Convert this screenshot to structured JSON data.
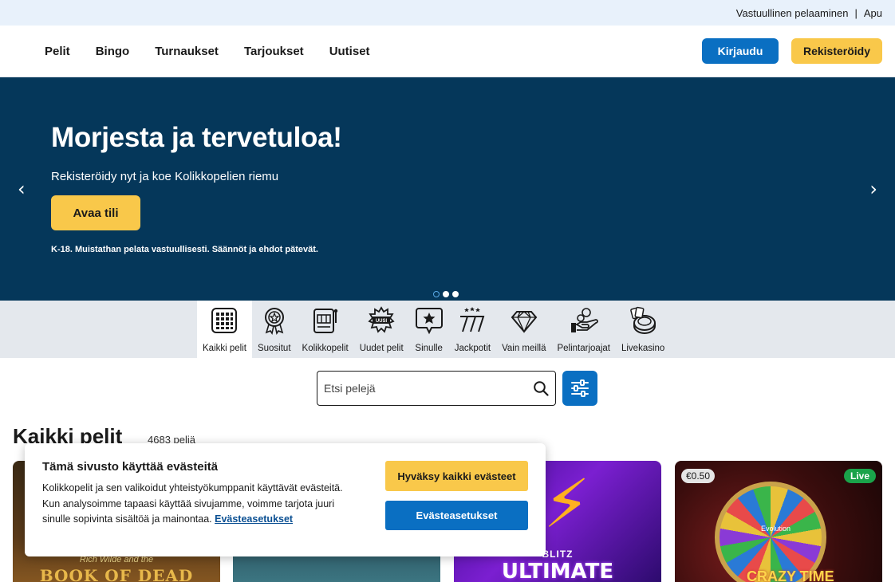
{
  "topbar": {
    "responsible": "Vastuullinen pelaaminen",
    "separator": "|",
    "help": "Apu"
  },
  "nav": {
    "items": [
      "Pelit",
      "Bingo",
      "Turnaukset",
      "Tarjoukset",
      "Uutiset"
    ]
  },
  "header": {
    "login_label": "Kirjaudu",
    "register_label": "Rekisteröidy"
  },
  "hero": {
    "title": "Morjesta ja tervetuloa!",
    "subtitle": "Rekisteröidy nyt ja koe Kolikkopelien riemu",
    "cta_label": "Avaa tili",
    "disclaimer": "K-18. Muistathan pelata vastuullisesti. Säännöt ja ehdot pätevät.",
    "prev_icon": "‹",
    "next_icon": "›",
    "slides": 3,
    "active_slide": 1
  },
  "categories": [
    {
      "label": "Kaikki pelit",
      "icon": "grid-icon",
      "active": true
    },
    {
      "label": "Suositut",
      "icon": "award-icon",
      "active": false
    },
    {
      "label": "Kolikkopelit",
      "icon": "slot-machine-icon",
      "active": false
    },
    {
      "label": "Uudet pelit",
      "icon": "new-badge-icon",
      "active": false
    },
    {
      "label": "Sinulle",
      "icon": "star-bubble-icon",
      "active": false
    },
    {
      "label": "Jackpotit",
      "icon": "jackpot-777-icon",
      "active": false
    },
    {
      "label": "Vain meillä",
      "icon": "diamond-icon",
      "active": false
    },
    {
      "label": "Pelintarjoajat",
      "icon": "hand-coins-icon",
      "active": false
    },
    {
      "label": "Livekasino",
      "icon": "roulette-icon",
      "active": false
    }
  ],
  "search": {
    "placeholder": "Etsi pelejä"
  },
  "section": {
    "title": "Kaikki pelit",
    "count": "4683 peliä"
  },
  "games": [
    {
      "title": "BOOK OF DEAD",
      "subtitle": "Rich Wilde and the"
    },
    {
      "title": ""
    },
    {
      "title": "ULTIMATE",
      "subtitle": "BLITZ"
    },
    {
      "title": "CRAZY TIME",
      "price_badge": "€0.50",
      "live_badge": "Live",
      "provider": "Evolution"
    }
  ],
  "cookie": {
    "title": "Tämä sivusto käyttää evästeitä",
    "text": "Kolikkopelit ja sen valikoidut yhteistyökumppanit käyttävät evästeitä. Kun analysoimme tapaasi käyttää sivujamme, voimme tarjota juuri sinulle sopivinta sisältöä ja mainontaa.",
    "link": "Evästeasetukset",
    "accept_label": "Hyväksy kaikki evästeet",
    "settings_label": "Evästeasetukset"
  },
  "colors": {
    "hero_bg": "#05375a",
    "primary_blue": "#0a6fc2",
    "accent_yellow": "#f9c84a",
    "topbar_bg": "#e8f1fb",
    "catbar_bg": "#e4e8ed"
  }
}
